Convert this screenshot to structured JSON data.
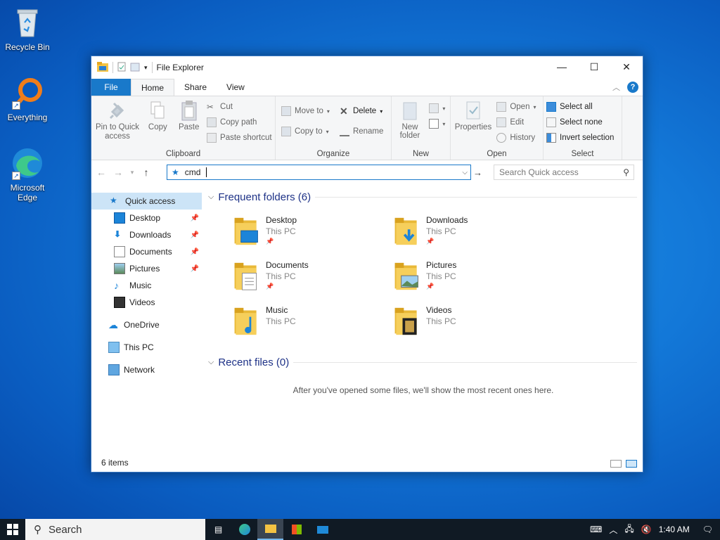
{
  "desktop": {
    "icons": [
      {
        "label": "Recycle Bin",
        "icon": "recycle-bin-icon"
      },
      {
        "label": "Everything",
        "icon": "everything-search-icon"
      },
      {
        "label": "Microsoft Edge",
        "icon": "edge-icon"
      }
    ]
  },
  "window": {
    "title": "File Explorer",
    "controls": {
      "minimize": "—",
      "maximize": "☐",
      "close": "✕"
    },
    "tabs": [
      "File",
      "Home",
      "Share",
      "View"
    ],
    "active_tab": "Home",
    "help": "?",
    "ribbon": {
      "clipboard": {
        "label": "Clipboard",
        "pin": "Pin to Quick access",
        "copy": "Copy",
        "paste": "Paste",
        "cut": "Cut",
        "copy_path": "Copy path",
        "paste_shortcut": "Paste shortcut"
      },
      "organize": {
        "label": "Organize",
        "move_to": "Move to",
        "copy_to": "Copy to",
        "delete": "Delete",
        "rename": "Rename"
      },
      "new": {
        "label": "New",
        "new_folder": "New folder"
      },
      "open": {
        "label": "Open",
        "properties": "Properties",
        "open": "Open",
        "edit": "Edit",
        "history": "History"
      },
      "select": {
        "label": "Select",
        "select_all": "Select all",
        "select_none": "Select none",
        "invert": "Invert selection"
      }
    },
    "address": {
      "value": "cmd",
      "search_placeholder": "Search Quick access"
    },
    "nav": {
      "quick_access": "Quick access",
      "items": [
        {
          "label": "Desktop",
          "pinned": true
        },
        {
          "label": "Downloads",
          "pinned": true
        },
        {
          "label": "Documents",
          "pinned": true
        },
        {
          "label": "Pictures",
          "pinned": true
        },
        {
          "label": "Music",
          "pinned": false
        },
        {
          "label": "Videos",
          "pinned": false
        }
      ],
      "onedrive": "OneDrive",
      "this_pc": "This PC",
      "network": "Network"
    },
    "frequent": {
      "header": "Frequent folders (6)",
      "folders": [
        {
          "name": "Desktop",
          "location": "This PC",
          "pinned": true
        },
        {
          "name": "Downloads",
          "location": "This PC",
          "pinned": true
        },
        {
          "name": "Documents",
          "location": "This PC",
          "pinned": true
        },
        {
          "name": "Pictures",
          "location": "This PC",
          "pinned": true
        },
        {
          "name": "Music",
          "location": "This PC",
          "pinned": false
        },
        {
          "name": "Videos",
          "location": "This PC",
          "pinned": false
        }
      ]
    },
    "recent": {
      "header": "Recent files (0)",
      "empty_message": "After you've opened some files, we'll show the most recent ones here."
    },
    "status": "6 items"
  },
  "taskbar": {
    "search_label": "Search",
    "time": "1:40 AM",
    "colors": {
      "taskbar": "#101a24",
      "accent": "#1979ca"
    }
  }
}
